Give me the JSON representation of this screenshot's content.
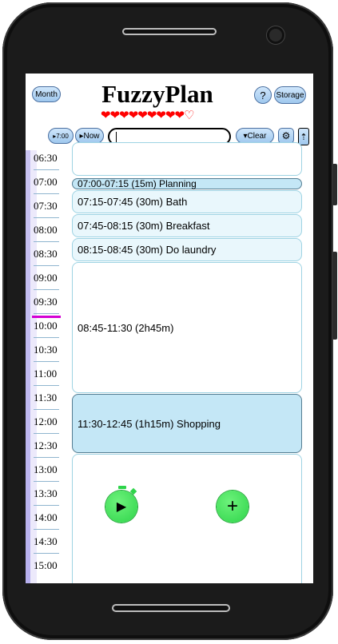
{
  "header": {
    "month_label": "Month",
    "title": "FuzzyPlan",
    "help_label": "?",
    "storage_label": "Storage",
    "hearts_filled": "❤❤❤❤❤❤❤❤❤",
    "hearts_empty": "♡"
  },
  "toolbar": {
    "time_button": "▸7:00",
    "now_button": "▸Now",
    "search_value": "",
    "clear_button": "▾Clear",
    "settings_icon": "⚙",
    "export_icon": "⇡"
  },
  "times": [
    "06:30",
    "07:00",
    "07:30",
    "08:00",
    "08:30",
    "09:00",
    "09:30",
    "10:00",
    "10:30",
    "11:00",
    "11:30",
    "12:00",
    "12:30",
    "13:00",
    "13:30",
    "14:00",
    "14:30",
    "15:00"
  ],
  "events": [
    {
      "label": ""
    },
    {
      "label": "07:00-07:15 (15m) Planning"
    },
    {
      "label": "07:15-07:45 (30m) Bath"
    },
    {
      "label": "07:45-08:15 (30m) Breakfast"
    },
    {
      "label": "08:15-08:45 (30m) Do laundry"
    },
    {
      "label": "08:45-11:30 (2h45m)"
    },
    {
      "label": "11:30-12:45 (1h15m) Shopping"
    },
    {
      "label": ""
    }
  ],
  "fab": {
    "play_icon": "▶",
    "add_icon": "+"
  }
}
